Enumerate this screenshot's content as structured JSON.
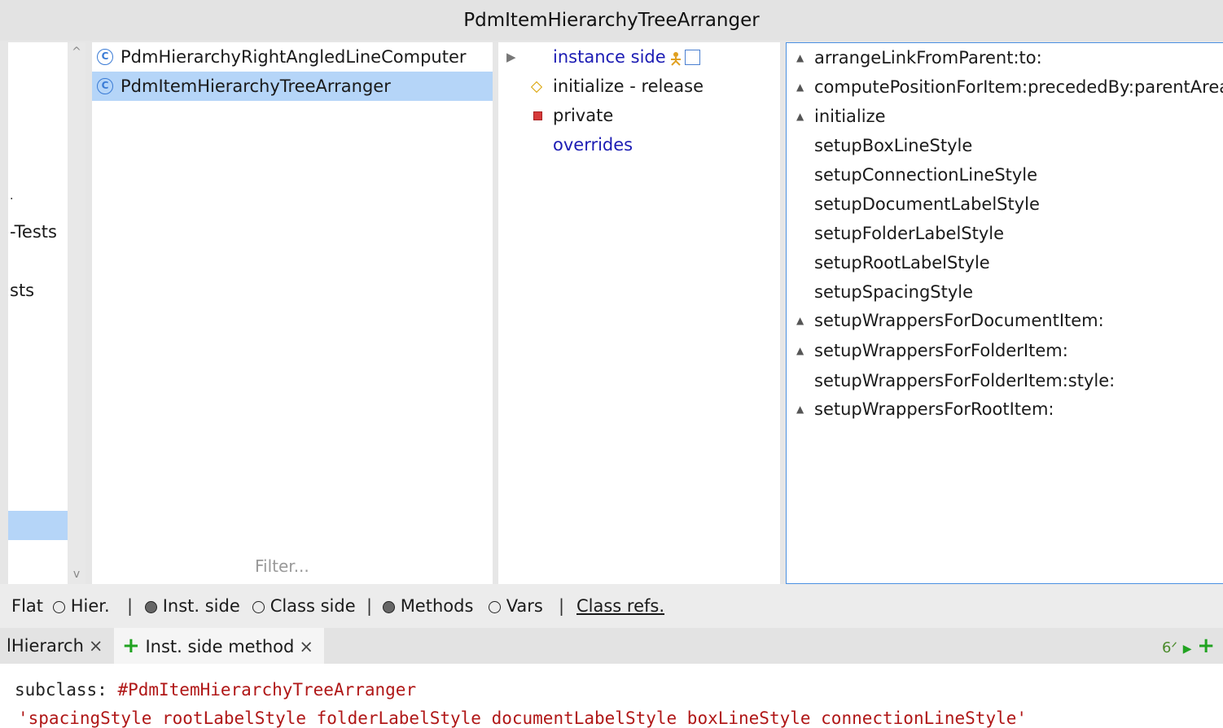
{
  "window": {
    "title": "PdmItemHierarchyTreeArranger"
  },
  "packages": {
    "items": [
      "-Tests",
      "sts"
    ]
  },
  "classes": {
    "items": [
      {
        "icon": "C",
        "label": "PdmHierarchyRightAngledLineComputer"
      },
      {
        "icon": "C",
        "label": "PdmItemHierarchyTreeArranger"
      }
    ],
    "filter_placeholder": "Filter..."
  },
  "protocols": {
    "instance_side": "instance side",
    "items": [
      {
        "label": "initialize - release",
        "icon": "diamond-icon"
      },
      {
        "label": "private",
        "icon": "red-square-icon"
      }
    ],
    "overrides": "overrides"
  },
  "methods": {
    "items": [
      {
        "label": "arrangeLinkFromParent:to:",
        "marker": "▲"
      },
      {
        "label": "computePositionForItem:precededBy:parentArea:",
        "marker": "▲"
      },
      {
        "label": "initialize",
        "marker": "▲"
      },
      {
        "label": "setupBoxLineStyle",
        "marker": ""
      },
      {
        "label": "setupConnectionLineStyle",
        "marker": ""
      },
      {
        "label": "setupDocumentLabelStyle",
        "marker": ""
      },
      {
        "label": "setupFolderLabelStyle",
        "marker": ""
      },
      {
        "label": "setupRootLabelStyle",
        "marker": ""
      },
      {
        "label": "setupSpacingStyle",
        "marker": ""
      },
      {
        "label": "setupWrappersForDocumentItem:",
        "marker": "▲"
      },
      {
        "label": "setupWrappersForFolderItem:",
        "marker": "▲"
      },
      {
        "label": "setupWrappersForFolderItem:style:",
        "marker": ""
      },
      {
        "label": "setupWrappersForRootItem:",
        "marker": "▲"
      }
    ]
  },
  "toolbar": {
    "flat": "Flat",
    "hier": "Hier.",
    "inst_side": "Inst. side",
    "class_side": "Class side",
    "methods": "Methods",
    "vars": "Vars",
    "class_refs": "Class refs.",
    "separator": "|"
  },
  "tabs": {
    "first": "lHierarch",
    "second": "Inst. side method",
    "close": "×",
    "plus": "+"
  },
  "code": {
    "line1_keyword": "subclass: ",
    "line1_symbol": "#PdmItemHierarchyTreeArranger",
    "line2": "'spacingStyle rootLabelStyle folderLabelStyle documentLabelStyle boxLineStyle connectionLineStyle'"
  }
}
